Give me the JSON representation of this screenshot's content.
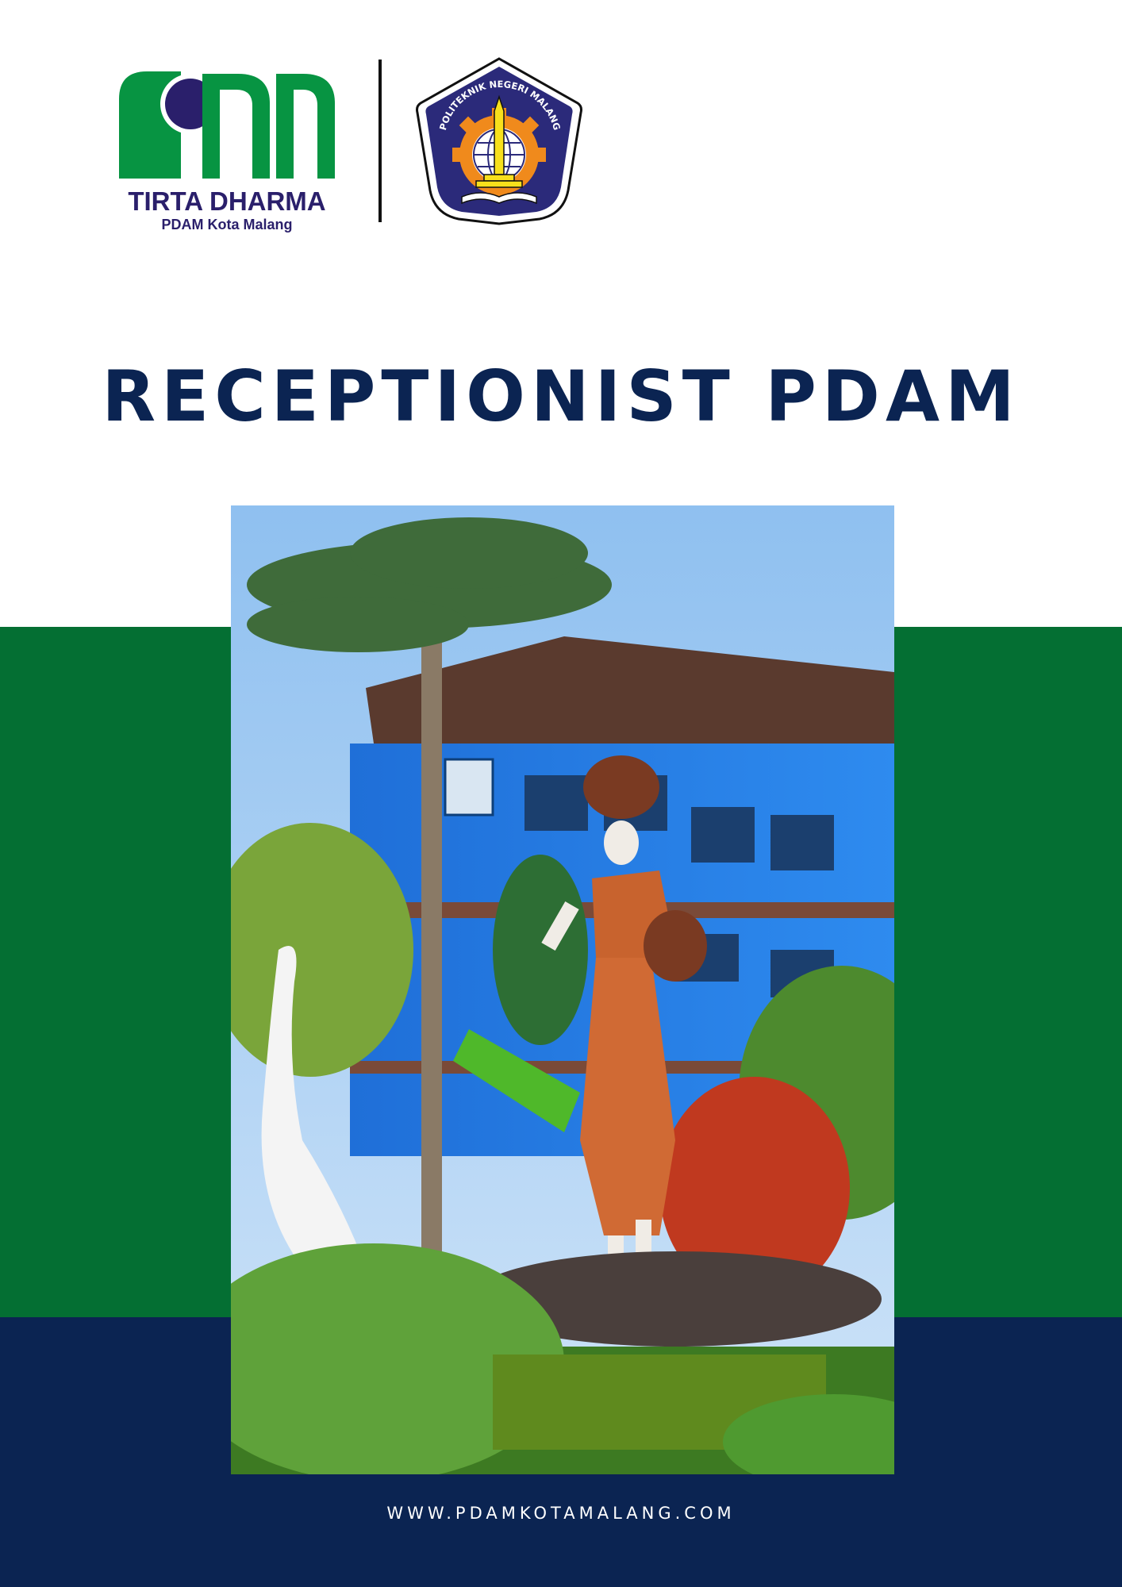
{
  "header": {
    "logo_tirta": {
      "name": "TIRTA DHARMA",
      "subname": "PDAM Kota Malang",
      "colors": {
        "green": "#079442",
        "navy": "#2a1f6b"
      }
    },
    "logo_polinema": {
      "ring_text": "POLITEKNIK NEGERI MALANG",
      "colors": {
        "navy": "#2b2a7a",
        "orange": "#f08a1c",
        "yellow": "#f7e01c"
      }
    }
  },
  "title": "RECEPTIONIST PDAM",
  "photo": {
    "description_icon": "building-statue-photo"
  },
  "footer": {
    "website": "WWW.PDAMKOTAMALANG.COM"
  },
  "colors": {
    "navy": "#0b2452",
    "green": "#046f33",
    "white": "#ffffff"
  }
}
